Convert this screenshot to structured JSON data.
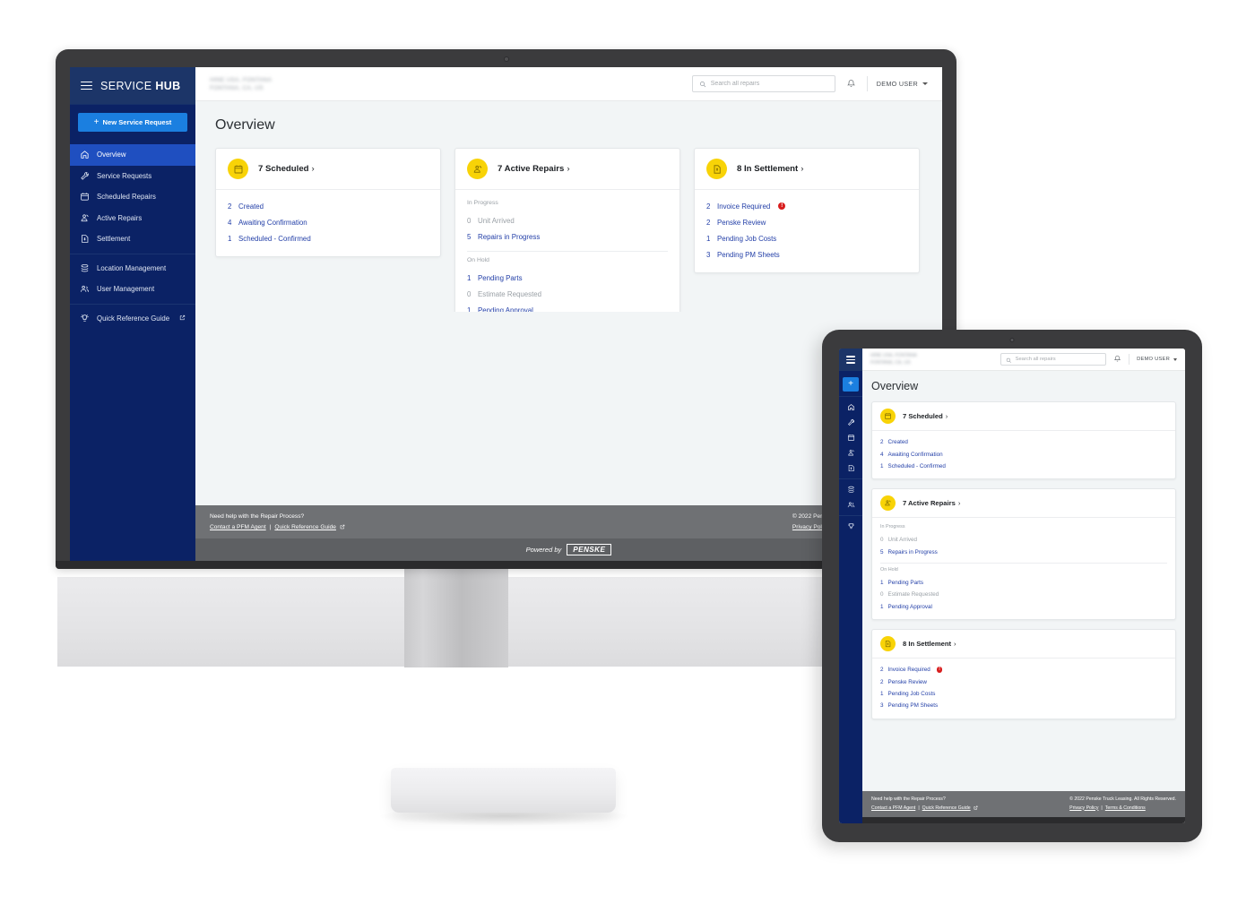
{
  "brand": {
    "service": "SERVICE",
    "hub": "HUB"
  },
  "colors": {
    "sidebar_navy": "#0b2265",
    "active_blue": "#1f4fc0",
    "cta_blue": "#1b7fe0",
    "accent_yellow": "#f8d307",
    "link_blue": "#2440a8",
    "alert_red": "#d81d1d",
    "footer_gray": "#6f7174"
  },
  "sidebar": {
    "cta_label": "New Service Request",
    "cta_plus": "+",
    "groups": [
      {
        "items": [
          {
            "label": "Overview",
            "icon": "home-icon",
            "active": true
          },
          {
            "label": "Service Requests",
            "icon": "wrench-icon",
            "active": false
          },
          {
            "label": "Scheduled Repairs",
            "icon": "calendar-icon",
            "active": false
          },
          {
            "label": "Active Repairs",
            "icon": "truck-repair-icon",
            "active": false
          },
          {
            "label": "Settlement",
            "icon": "invoice-icon",
            "active": false
          }
        ]
      },
      {
        "items": [
          {
            "label": "Location Management",
            "icon": "layers-icon",
            "active": false
          },
          {
            "label": "User Management",
            "icon": "users-icon",
            "active": false
          }
        ]
      },
      {
        "items": [
          {
            "label": "Quick Reference Guide",
            "icon": "bulb-icon",
            "active": false,
            "external": true
          }
        ]
      }
    ]
  },
  "topbar": {
    "location_line1": "HINE USA, FONTANA",
    "location_line2": "FONTANA, CA, US",
    "search_placeholder": "Search all repairs",
    "user_label": "DEMO USER",
    "notification_icon": "bell-icon",
    "search_icon": "search-icon"
  },
  "main": {
    "page_title": "Overview"
  },
  "cards": [
    {
      "icon": "calendar-icon",
      "title": "7 Scheduled",
      "arrow": "›",
      "sections": [
        {
          "label": null,
          "rows": [
            {
              "num": "2",
              "label": "Created",
              "zero": false,
              "alert": false
            },
            {
              "num": "4",
              "label": "Awaiting Confirmation",
              "zero": false,
              "alert": false
            },
            {
              "num": "1",
              "label": "Scheduled - Confirmed",
              "zero": false,
              "alert": false
            }
          ]
        }
      ]
    },
    {
      "icon": "truck-repair-icon",
      "title": "7 Active Repairs",
      "arrow": "›",
      "sections": [
        {
          "label": "In Progress",
          "rows": [
            {
              "num": "0",
              "label": "Unit Arrived",
              "zero": true,
              "alert": false
            },
            {
              "num": "5",
              "label": "Repairs in Progress",
              "zero": false,
              "alert": false
            }
          ]
        },
        {
          "label": "On Hold",
          "rows": [
            {
              "num": "1",
              "label": "Pending Parts",
              "zero": false,
              "alert": false
            },
            {
              "num": "0",
              "label": "Estimate Requested",
              "zero": true,
              "alert": false
            },
            {
              "num": "1",
              "label": "Pending Approval",
              "zero": false,
              "alert": false
            }
          ]
        }
      ]
    },
    {
      "icon": "invoice-icon",
      "title": "8 In Settlement",
      "arrow": "›",
      "sections": [
        {
          "label": null,
          "rows": [
            {
              "num": "2",
              "label": "Invoice Required",
              "zero": false,
              "alert": true,
              "alert_glyph": "!"
            },
            {
              "num": "2",
              "label": "Penske Review",
              "zero": false,
              "alert": false
            },
            {
              "num": "1",
              "label": "Pending Job Costs",
              "zero": false,
              "alert": false
            },
            {
              "num": "3",
              "label": "Pending PM Sheets",
              "zero": false,
              "alert": false
            }
          ]
        }
      ]
    }
  ],
  "footer": {
    "help_text": "Need help with the Repair Process?",
    "link_contact": "Contact a PFM Agent",
    "separator": "|",
    "link_guide": "Quick Reference Guide",
    "copyright": "© 2022 Penske Truck Leasing. All Rights Reserved.",
    "link_privacy": "Privacy Policy",
    "link_terms": "Terms & Conditions",
    "powered_by": "Powered by",
    "penske_logo_text": "PENSKE"
  }
}
